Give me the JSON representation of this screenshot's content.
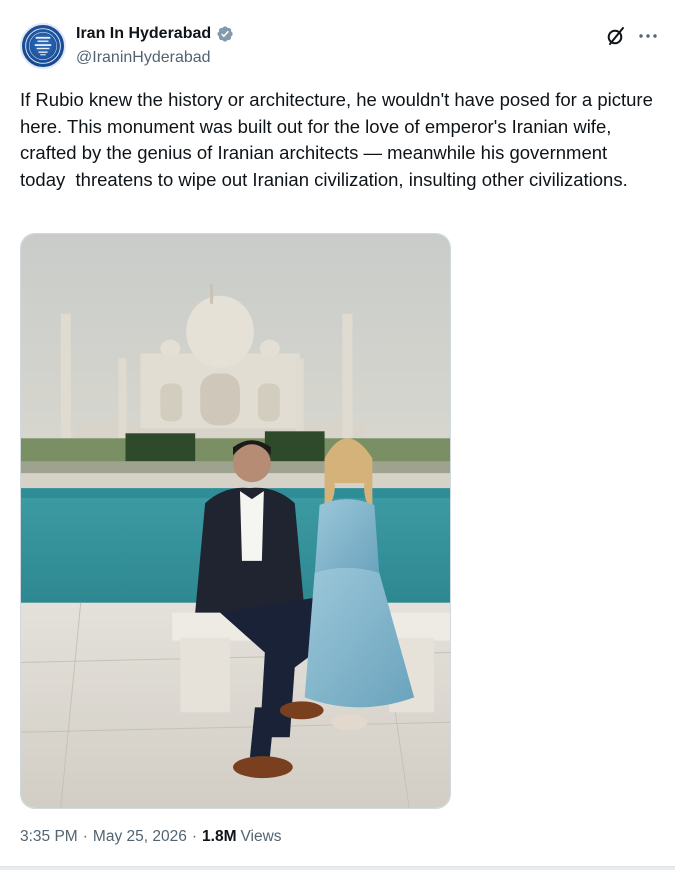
{
  "author": {
    "display_name": "Iran In Hyderabad",
    "handle": "@IraninHyderabad",
    "verified_icon": "verified-badge-icon",
    "verified_color": "#829aab"
  },
  "actions": {
    "grok_icon": "grok-icon",
    "more_icon": "more-dots-icon"
  },
  "tweet": {
    "text": "If Rubio knew the history or architecture, he wouldn't have posed for a picture here. This monument was built out for the love of emperor's Iranian wife, crafted by the genius of Iranian architects — meanwhile his government today  threatens to wipe out Iranian civilization, insulting other civilizations."
  },
  "meta": {
    "time": "3:35 PM",
    "separator": "·",
    "date": "May 25, 2026",
    "views_count": "1.8M",
    "views_label": "Views"
  },
  "colors": {
    "text": "#0f1419",
    "secondary": "#536471",
    "border": "#cfd9de"
  }
}
